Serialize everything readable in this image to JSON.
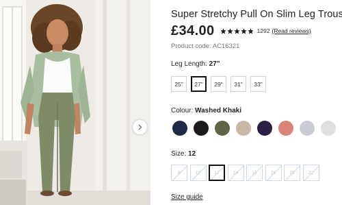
{
  "product": {
    "title": "Super Stretchy Pull On Slim Leg Trousers",
    "price": "£34.00",
    "rating": 5,
    "review_count": "1292",
    "read_reviews_label": "(Read reviews)",
    "product_code": "Product code: AC16321"
  },
  "leg_length": {
    "label": "Leg Length:",
    "selected": "27\"",
    "options": [
      "25\"",
      "27\"",
      "29\"",
      "31\"",
      "33\""
    ],
    "selected_index": 1
  },
  "colour": {
    "label": "Colour:",
    "selected": "Washed Khaki",
    "swatches": [
      "#1f2a44",
      "#1e1b1d",
      "#5f6647",
      "#c8b8a6",
      "#2c1f45",
      "#d98477",
      "#c9ccd3",
      "#dedfdf"
    ]
  },
  "size": {
    "label": "Size:",
    "selected": "12",
    "options": [
      "8",
      "10",
      "12",
      "14",
      "16",
      "18",
      "20",
      "22"
    ],
    "selected_index": 2
  },
  "size_guide_label": "Size guide",
  "icons": {
    "star": "star-icon",
    "next": "chevron-right-icon"
  }
}
